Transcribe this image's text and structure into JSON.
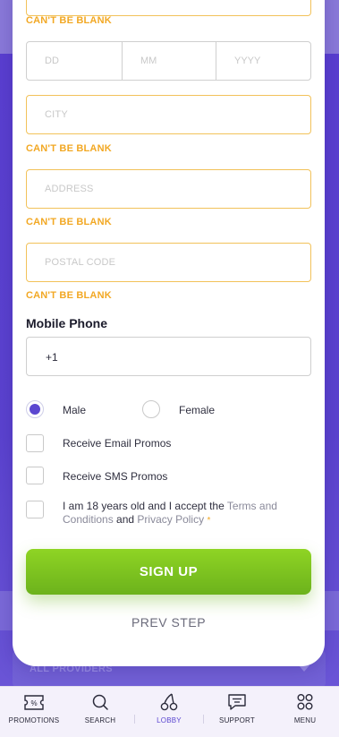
{
  "form": {
    "errors": {
      "top": "CAN'T BE BLANK",
      "city": "CAN'T BE BLANK",
      "address": "CAN'T BE BLANK",
      "postal": "CAN'T BE BLANK"
    },
    "date": {
      "day_placeholder": "DD",
      "month_placeholder": "MM",
      "year_placeholder": "YYYY"
    },
    "city_placeholder": "CITY",
    "address_placeholder": "ADDRESS",
    "postal_placeholder": "POSTAL CODE",
    "mobile_label": "Mobile Phone",
    "mobile_value": "+1",
    "gender": {
      "selected": "Male",
      "options": [
        "Male",
        "Female"
      ]
    },
    "email_promos_label": "Receive Email Promos",
    "sms_promos_label": "Receive SMS Promos",
    "terms": {
      "part1": "I am 18 years old and I accept the ",
      "terms_link": "Terms and Conditions",
      "part2": " and ",
      "privacy_link": "Privacy Policy",
      "required_mark": "*"
    },
    "submit_label": "SIGN UP",
    "prev_label": "PREV STEP"
  },
  "background": {
    "providers_label": "ALL PROVIDERS"
  },
  "bottom_nav": {
    "items": [
      {
        "label": "PROMOTIONS",
        "icon": "promotions-icon"
      },
      {
        "label": "SEARCH",
        "icon": "search-icon"
      },
      {
        "label": "LOBBY",
        "icon": "cherries-icon",
        "active": true
      },
      {
        "label": "SUPPORT",
        "icon": "chat-icon"
      },
      {
        "label": "MENU",
        "icon": "grid-icon"
      }
    ]
  },
  "colors": {
    "accent": "#5b47d0",
    "error": "#f2a824",
    "cta": "#7cc31f"
  }
}
